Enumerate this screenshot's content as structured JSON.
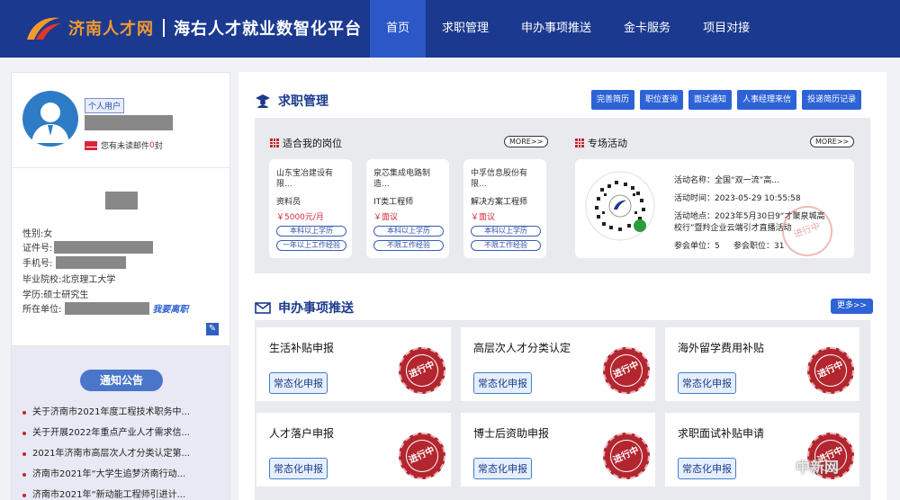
{
  "header": {
    "logo_title": "济南人才网",
    "platform_title": "海右人才就业数智化平台",
    "nav": [
      "首页",
      "求职管理",
      "申办事项推送",
      "金卡服务",
      "项目对接"
    ],
    "nav_active": "首页"
  },
  "profile": {
    "role": "个人用户",
    "mail_prefix": "您有未读邮件",
    "mail_count": "0",
    "mail_suffix": "封"
  },
  "info": {
    "gender_label": "性别:",
    "gender": "女",
    "id_label": "证件号:",
    "phone_label": "手机号:",
    "school_label": "毕业院校:",
    "school": "北京理工大学",
    "degree_label": "学历:",
    "degree": "硕士研究生",
    "employer_label": "所在单位:",
    "leave_link": "我要离职"
  },
  "notice": {
    "title": "通知公告",
    "items": [
      "关于济南市2021年度工程技术职务中...",
      "关于开展2022年重点产业人才需求信...",
      "2021年济南市高层次人才分类认定第...",
      "济南市2021年“大学生追梦济南行动...",
      "济南市2021年“新动能工程师引进计..."
    ]
  },
  "job_mgmt": {
    "title": "求职管理",
    "actions": [
      "完善简历",
      "职位查询",
      "面试通知",
      "人事经理来信",
      "投递简历记录"
    ],
    "suitable_title": "适合我的岗位",
    "more": "MORE>>",
    "jobs": [
      {
        "company": "山东宝冶建设有限...",
        "title": "资料员",
        "salary": "￥5000元/月",
        "tags": [
          "本科以上学历",
          "一年以上工作经验"
        ]
      },
      {
        "company": "泉芯集成电路制造...",
        "title": "IT类工程师",
        "salary": "￥面议",
        "tags": [
          "本科以上学历",
          "不限工作经验"
        ]
      },
      {
        "company": "中孚信息股份有限...",
        "title": "解决方案工程师",
        "salary": "￥面议",
        "tags": [
          "本科以上学历",
          "不限工作经验"
        ]
      }
    ],
    "event_title": "专场活动",
    "event": {
      "name": "活动名称：全国“双一流”高...",
      "time": "活动时间：2023-05-29 10:55:58",
      "place_1": "活动地点：2023年5月30日9“才聚泉城高",
      "place_2": "校行”暨羚企业云端引才直播活动",
      "units": "参会单位：5",
      "positions": "参会职位：31",
      "stamp": "进行中"
    }
  },
  "apply": {
    "title": "申办事项推送",
    "more": "更多>>",
    "cards": [
      {
        "title": "生活补贴申报",
        "button": "常态化申报",
        "stamp": "进行中"
      },
      {
        "title": "高层次人才分类认定",
        "button": "常态化申报",
        "stamp": "进行中"
      },
      {
        "title": "海外留学费用补贴",
        "button": "常态化申报",
        "stamp": "进行中"
      },
      {
        "title": "人才落户申报",
        "button": "常态化申报",
        "stamp": "进行中"
      },
      {
        "title": "博士后资助申报",
        "button": "常态化申报",
        "stamp": "进行中"
      },
      {
        "title": "求职面试补贴申请",
        "button": "常态化申报",
        "stamp": "进行中"
      }
    ]
  },
  "watermark": "中新网",
  "colors": {
    "header": "#1b3a8f",
    "nav_active": "#2c57c7",
    "accent": "#2e63d6",
    "stamp": "#b3262f",
    "logo": "#f29a2e"
  }
}
